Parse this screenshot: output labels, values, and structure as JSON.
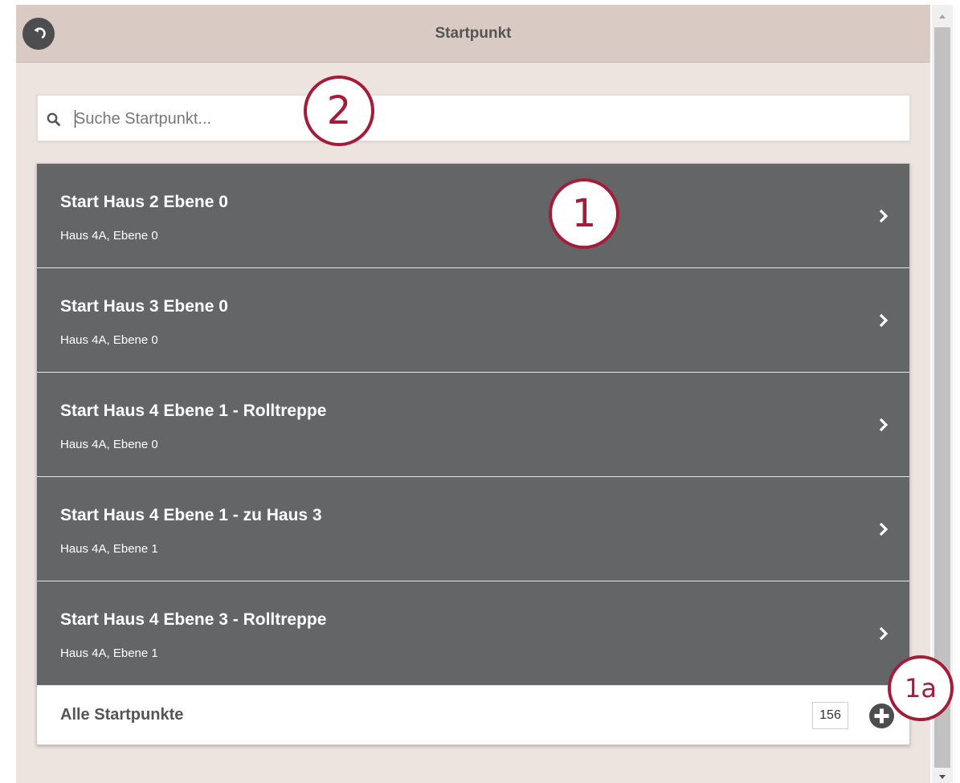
{
  "header": {
    "title": "Startpunkt",
    "back_icon": "back-arrow-icon"
  },
  "search": {
    "placeholder": "Suche Startpunkt...",
    "value": "",
    "icon": "search-icon"
  },
  "list": {
    "items": [
      {
        "title": "Start Haus 2 Ebene 0",
        "subtitle": "Haus 4A, Ebene 0"
      },
      {
        "title": "Start Haus 3 Ebene 0",
        "subtitle": "Haus 4A, Ebene 0"
      },
      {
        "title": "Start Haus 4 Ebene 1 - Rolltreppe",
        "subtitle": "Haus 4A, Ebene 0"
      },
      {
        "title": "Start Haus 4 Ebene 1 - zu Haus 3",
        "subtitle": "Haus 4A, Ebene 1"
      },
      {
        "title": "Start Haus 4 Ebene 3 - Rolltreppe",
        "subtitle": "Haus 4A, Ebene 1"
      }
    ],
    "footer": {
      "label": "Alle Startpunkte",
      "count": "156",
      "icon": "plus-circle-icon"
    }
  },
  "annotations": {
    "callout_1": "1",
    "callout_2": "2",
    "callout_1a": "1a"
  },
  "colors": {
    "header_bg": "#d9cbc3",
    "page_bg": "#ede4e0",
    "row_bg": "#646567",
    "callout": "#a31d3a"
  }
}
